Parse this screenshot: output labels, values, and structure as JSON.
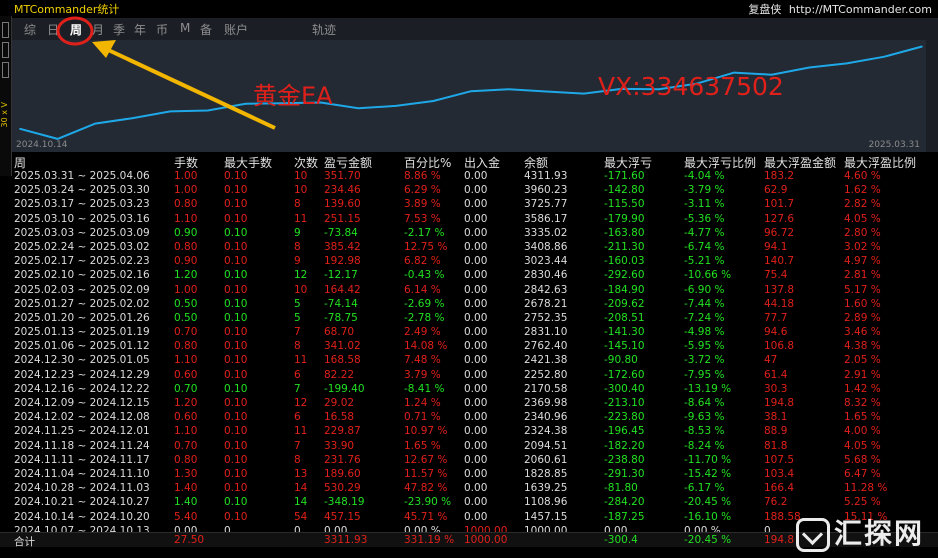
{
  "window": {
    "title": "MTCommander统计",
    "brand": "复盘侠",
    "url": "http://MTCommander.com"
  },
  "tabs": [
    "综",
    "日",
    "周",
    "月",
    "季",
    "年",
    "币",
    "M",
    "备",
    "账户",
    "轨迹"
  ],
  "active_tab": "周",
  "chart": {
    "start_date": "2024.10.14",
    "end_date": "2025.03.31"
  },
  "annotations": {
    "left": "黄金EA",
    "right": "VX:334637502"
  },
  "left_strip_text": "30 x V",
  "chart_data": {
    "type": "line",
    "x": [
      "2024.10.14",
      "2024.10.21",
      "2024.10.28",
      "2024.11.04",
      "2024.11.11",
      "2024.11.18",
      "2024.11.25",
      "2024.12.02",
      "2024.12.09",
      "2024.12.16",
      "2024.12.23",
      "2024.12.30",
      "2025.01.06",
      "2025.01.13",
      "2025.01.20",
      "2025.01.27",
      "2025.02.03",
      "2025.02.10",
      "2025.02.17",
      "2025.02.24",
      "2025.03.03",
      "2025.03.10",
      "2025.03.17",
      "2025.03.24",
      "2025.03.31"
    ],
    "y": [
      1457.15,
      1108.96,
      1639.25,
      1828.85,
      2060.61,
      2094.51,
      2324.38,
      2340.96,
      2369.98,
      2170.58,
      2252.8,
      2421.38,
      2762.4,
      2831.1,
      2752.35,
      2678.21,
      2842.63,
      2830.46,
      3023.44,
      3408.86,
      3335.02,
      3586.17,
      3725.77,
      3960.23,
      4311.93
    ],
    "series": [
      {
        "color": "#1fa8e8"
      }
    ],
    "ylim": [
      1000,
      4400
    ]
  },
  "table": {
    "headers": [
      "周",
      "手数",
      "最大手数",
      "次数",
      "盈亏金额",
      "百分比%",
      "出入金",
      "余额",
      "最大浮亏",
      "最大浮亏比例",
      "最大浮盈金额",
      "最大浮盈比例"
    ],
    "rows": [
      {
        "week": "2025.03.31 ~ 2025.04.06",
        "lots": "1.00",
        "maxlots": "0.10",
        "count": "10",
        "pnl": "351.70",
        "pct": "8.86 %",
        "io": "0.00",
        "bal": "4311.93",
        "maxf": "-171.60",
        "maxfp": "-4.04 %",
        "maxp": "183.2",
        "maxpp": "4.60 %",
        "sign": "pos"
      },
      {
        "week": "2025.03.24 ~ 2025.03.30",
        "lots": "1.00",
        "maxlots": "0.10",
        "count": "10",
        "pnl": "234.46",
        "pct": "6.29 %",
        "io": "0.00",
        "bal": "3960.23",
        "maxf": "-142.80",
        "maxfp": "-3.79 %",
        "maxp": "62.9",
        "maxpp": "1.62 %",
        "sign": "pos"
      },
      {
        "week": "2025.03.17 ~ 2025.03.23",
        "lots": "0.80",
        "maxlots": "0.10",
        "count": "8",
        "pnl": "139.60",
        "pct": "3.89 %",
        "io": "0.00",
        "bal": "3725.77",
        "maxf": "-115.50",
        "maxfp": "-3.11 %",
        "maxp": "101.7",
        "maxpp": "2.82 %",
        "sign": "pos"
      },
      {
        "week": "2025.03.10 ~ 2025.03.16",
        "lots": "1.10",
        "maxlots": "0.10",
        "count": "11",
        "pnl": "251.15",
        "pct": "7.53 %",
        "io": "0.00",
        "bal": "3586.17",
        "maxf": "-179.90",
        "maxfp": "-5.36 %",
        "maxp": "127.6",
        "maxpp": "4.05 %",
        "sign": "pos"
      },
      {
        "week": "2025.03.03 ~ 2025.03.09",
        "lots": "0.90",
        "maxlots": "0.10",
        "count": "9",
        "pnl": "-73.84",
        "pct": "-2.17 %",
        "io": "0.00",
        "bal": "3335.02",
        "maxf": "-163.80",
        "maxfp": "-4.77 %",
        "maxp": "96.72",
        "maxpp": "2.80 %",
        "sign": "neg"
      },
      {
        "week": "2025.02.24 ~ 2025.03.02",
        "lots": "0.80",
        "maxlots": "0.10",
        "count": "8",
        "pnl": "385.42",
        "pct": "12.75 %",
        "io": "0.00",
        "bal": "3408.86",
        "maxf": "-211.30",
        "maxfp": "-6.74 %",
        "maxp": "94.1",
        "maxpp": "3.02 %",
        "sign": "pos"
      },
      {
        "week": "2025.02.17 ~ 2025.02.23",
        "lots": "0.90",
        "maxlots": "0.10",
        "count": "9",
        "pnl": "192.98",
        "pct": "6.82 %",
        "io": "0.00",
        "bal": "3023.44",
        "maxf": "-160.03",
        "maxfp": "-5.21 %",
        "maxp": "140.7",
        "maxpp": "4.97 %",
        "sign": "pos"
      },
      {
        "week": "2025.02.10 ~ 2025.02.16",
        "lots": "1.20",
        "maxlots": "0.10",
        "count": "12",
        "pnl": "-12.17",
        "pct": "-0.43 %",
        "io": "0.00",
        "bal": "2830.46",
        "maxf": "-292.60",
        "maxfp": "-10.66 %",
        "maxp": "75.4",
        "maxpp": "2.81 %",
        "sign": "neg"
      },
      {
        "week": "2025.02.03 ~ 2025.02.09",
        "lots": "1.00",
        "maxlots": "0.10",
        "count": "10",
        "pnl": "164.42",
        "pct": "6.14 %",
        "io": "0.00",
        "bal": "2842.63",
        "maxf": "-184.90",
        "maxfp": "-6.90 %",
        "maxp": "137.8",
        "maxpp": "5.17 %",
        "sign": "pos"
      },
      {
        "week": "2025.01.27 ~ 2025.02.02",
        "lots": "0.50",
        "maxlots": "0.10",
        "count": "5",
        "pnl": "-74.14",
        "pct": "-2.69 %",
        "io": "0.00",
        "bal": "2678.21",
        "maxf": "-209.62",
        "maxfp": "-7.44 %",
        "maxp": "44.18",
        "maxpp": "1.60 %",
        "sign": "neg"
      },
      {
        "week": "2025.01.20 ~ 2025.01.26",
        "lots": "0.50",
        "maxlots": "0.10",
        "count": "5",
        "pnl": "-78.75",
        "pct": "-2.78 %",
        "io": "0.00",
        "bal": "2752.35",
        "maxf": "-208.51",
        "maxfp": "-7.24 %",
        "maxp": "77.7",
        "maxpp": "2.89 %",
        "sign": "neg"
      },
      {
        "week": "2025.01.13 ~ 2025.01.19",
        "lots": "0.70",
        "maxlots": "0.10",
        "count": "7",
        "pnl": "68.70",
        "pct": "2.49 %",
        "io": "0.00",
        "bal": "2831.10",
        "maxf": "-141.30",
        "maxfp": "-4.98 %",
        "maxp": "94.6",
        "maxpp": "3.46 %",
        "sign": "pos"
      },
      {
        "week": "2025.01.06 ~ 2025.01.12",
        "lots": "0.80",
        "maxlots": "0.10",
        "count": "8",
        "pnl": "341.02",
        "pct": "14.08 %",
        "io": "0.00",
        "bal": "2762.40",
        "maxf": "-145.10",
        "maxfp": "-5.95 %",
        "maxp": "106.8",
        "maxpp": "4.38 %",
        "sign": "pos"
      },
      {
        "week": "2024.12.30 ~ 2025.01.05",
        "lots": "1.10",
        "maxlots": "0.10",
        "count": "11",
        "pnl": "168.58",
        "pct": "7.48 %",
        "io": "0.00",
        "bal": "2421.38",
        "maxf": "-90.80",
        "maxfp": "-3.72 %",
        "maxp": "47",
        "maxpp": "2.05 %",
        "sign": "pos"
      },
      {
        "week": "2024.12.23 ~ 2024.12.29",
        "lots": "0.60",
        "maxlots": "0.10",
        "count": "6",
        "pnl": "82.22",
        "pct": "3.79 %",
        "io": "0.00",
        "bal": "2252.80",
        "maxf": "-172.60",
        "maxfp": "-7.95 %",
        "maxp": "61.4",
        "maxpp": "2.91 %",
        "sign": "pos"
      },
      {
        "week": "2024.12.16 ~ 2024.12.22",
        "lots": "0.70",
        "maxlots": "0.10",
        "count": "7",
        "pnl": "-199.40",
        "pct": "-8.41 %",
        "io": "0.00",
        "bal": "2170.58",
        "maxf": "-300.40",
        "maxfp": "-13.19 %",
        "maxp": "30.3",
        "maxpp": "1.42 %",
        "sign": "neg"
      },
      {
        "week": "2024.12.09 ~ 2024.12.15",
        "lots": "1.20",
        "maxlots": "0.10",
        "count": "12",
        "pnl": "29.02",
        "pct": "1.24 %",
        "io": "0.00",
        "bal": "2369.98",
        "maxf": "-213.10",
        "maxfp": "-8.64 %",
        "maxp": "194.8",
        "maxpp": "8.32 %",
        "sign": "pos"
      },
      {
        "week": "2024.12.02 ~ 2024.12.08",
        "lots": "0.60",
        "maxlots": "0.10",
        "count": "6",
        "pnl": "16.58",
        "pct": "0.71 %",
        "io": "0.00",
        "bal": "2340.96",
        "maxf": "-223.80",
        "maxfp": "-9.63 %",
        "maxp": "38.1",
        "maxpp": "1.65 %",
        "sign": "pos"
      },
      {
        "week": "2024.11.25 ~ 2024.12.01",
        "lots": "1.10",
        "maxlots": "0.10",
        "count": "11",
        "pnl": "229.87",
        "pct": "10.97 %",
        "io": "0.00",
        "bal": "2324.38",
        "maxf": "-196.45",
        "maxfp": "-8.53 %",
        "maxp": "88.9",
        "maxpp": "4.00 %",
        "sign": "pos"
      },
      {
        "week": "2024.11.18 ~ 2024.11.24",
        "lots": "0.70",
        "maxlots": "0.10",
        "count": "7",
        "pnl": "33.90",
        "pct": "1.65 %",
        "io": "0.00",
        "bal": "2094.51",
        "maxf": "-182.20",
        "maxfp": "-8.24 %",
        "maxp": "81.8",
        "maxpp": "4.05 %",
        "sign": "pos"
      },
      {
        "week": "2024.11.11 ~ 2024.11.17",
        "lots": "0.80",
        "maxlots": "0.10",
        "count": "8",
        "pnl": "231.76",
        "pct": "12.67 %",
        "io": "0.00",
        "bal": "2060.61",
        "maxf": "-238.80",
        "maxfp": "-11.70 %",
        "maxp": "107.5",
        "maxpp": "5.68 %",
        "sign": "pos"
      },
      {
        "week": "2024.11.04 ~ 2024.11.10",
        "lots": "1.30",
        "maxlots": "0.10",
        "count": "13",
        "pnl": "189.60",
        "pct": "11.57 %",
        "io": "0.00",
        "bal": "1828.85",
        "maxf": "-291.30",
        "maxfp": "-15.42 %",
        "maxp": "103.4",
        "maxpp": "6.47 %",
        "sign": "pos"
      },
      {
        "week": "2024.10.28 ~ 2024.11.03",
        "lots": "1.40",
        "maxlots": "0.10",
        "count": "14",
        "pnl": "530.29",
        "pct": "47.82 %",
        "io": "0.00",
        "bal": "1639.25",
        "maxf": "-81.80",
        "maxfp": "-6.17 %",
        "maxp": "166.4",
        "maxpp": "11.28 %",
        "sign": "pos"
      },
      {
        "week": "2024.10.21 ~ 2024.10.27",
        "lots": "1.40",
        "maxlots": "0.10",
        "count": "14",
        "pnl": "-348.19",
        "pct": "-23.90 %",
        "io": "0.00",
        "bal": "1108.96",
        "maxf": "-284.20",
        "maxfp": "-20.45 %",
        "maxp": "76.2",
        "maxpp": "5.25 %",
        "sign": "neg"
      },
      {
        "week": "2024.10.14 ~ 2024.10.20",
        "lots": "5.40",
        "maxlots": "0.10",
        "count": "54",
        "pnl": "457.15",
        "pct": "45.71 %",
        "io": "0.00",
        "bal": "1457.15",
        "maxf": "-187.25",
        "maxfp": "-16.10 %",
        "maxp": "188.58",
        "maxpp": "15.11 %",
        "sign": "pos"
      },
      {
        "week": "2024.10.07 ~ 2024.10.13",
        "lots": "0.00",
        "maxlots": "0",
        "count": "0",
        "pnl": "0.00",
        "pct": "0.00 %",
        "io": "1000.00",
        "bal": "1000.00",
        "maxf": "0.00",
        "maxfp": "0.00 %",
        "maxp": "0",
        "maxpp": "",
        "sign": "zero"
      }
    ],
    "total": {
      "label": "合计",
      "lots": "27.50",
      "pnl": "3311.93",
      "pct": "331.19 %",
      "io": "1000.00",
      "maxf": "-300.4",
      "maxfp": "-20.45 %",
      "maxp": "194.8"
    }
  },
  "watermark": "汇探网"
}
